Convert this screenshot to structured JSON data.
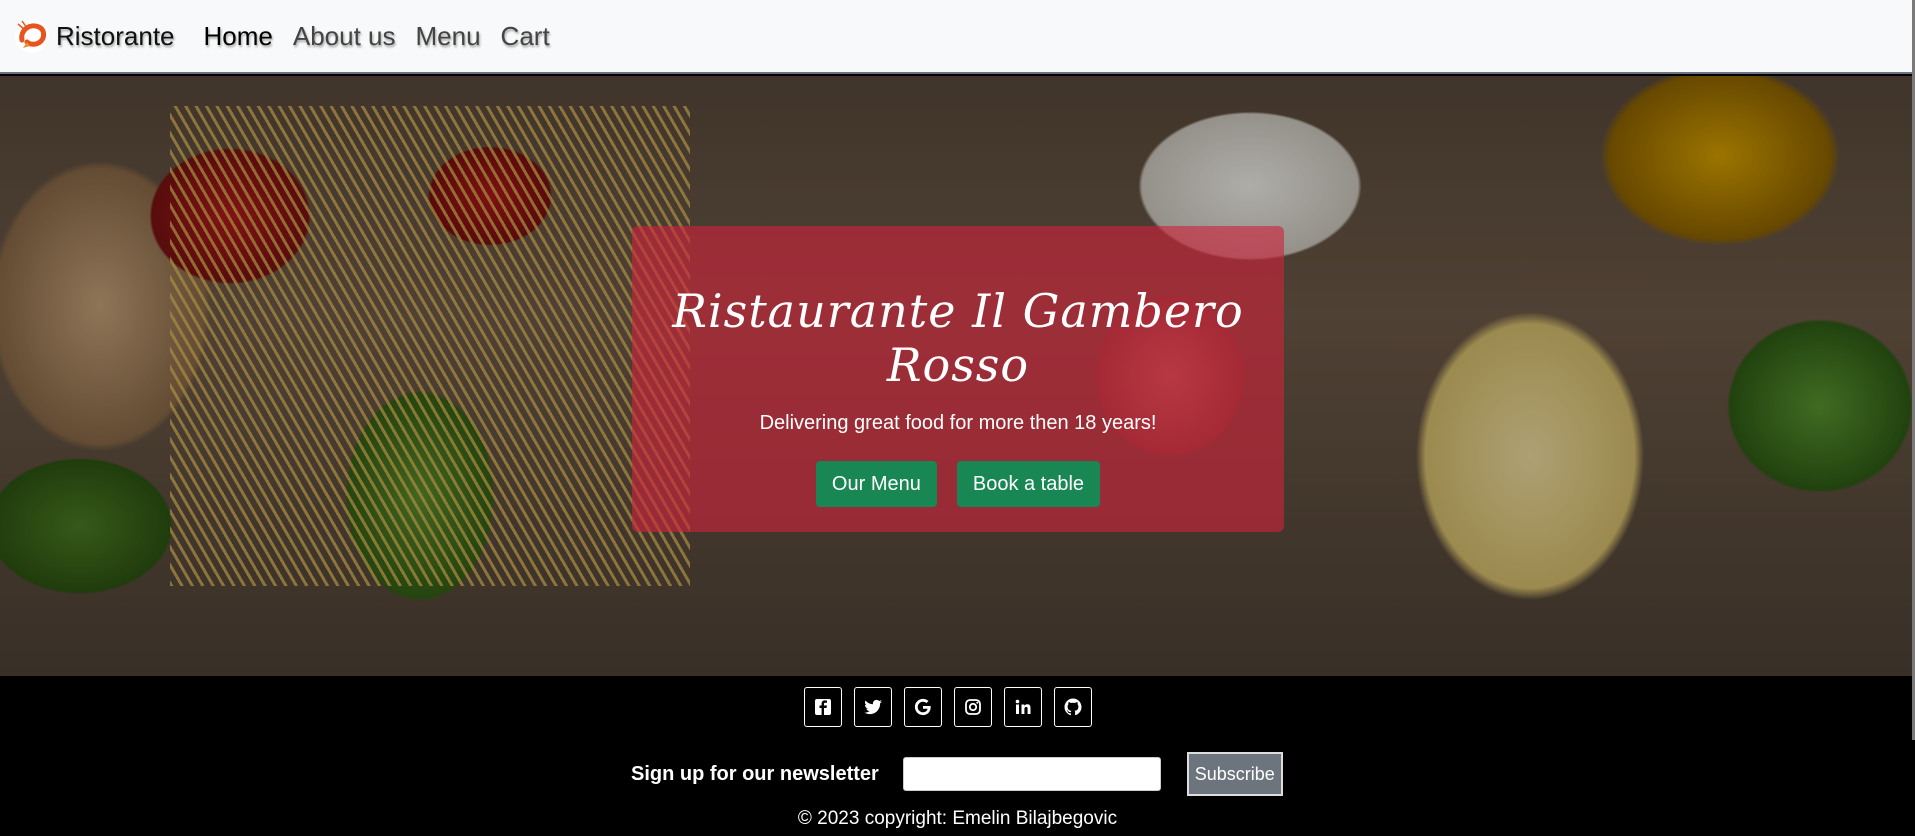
{
  "navbar": {
    "brand": "Ristorante",
    "logo_icon": "shrimp-icon",
    "links": [
      "Home",
      "About us",
      "Menu",
      "Cart"
    ],
    "active_link": "Home"
  },
  "hero": {
    "title": "Ristaurante Il Gambero Rosso",
    "subtitle": "Delivering great food for more then 18 years!",
    "buttons": [
      "Our Menu",
      "Book a table"
    ],
    "card_color": "#cd233c",
    "button_color": "#198754"
  },
  "footer": {
    "social_icons": [
      "facebook-icon",
      "twitter-icon",
      "google-icon",
      "instagram-icon",
      "linkedin-icon",
      "github-icon"
    ],
    "newsletter_label": "Sign up for our newsletter",
    "newsletter_placeholder": "",
    "subscribe_label": "Subscribe",
    "copyright": "© 2023 copyright: Emelin Bilajbegovic"
  }
}
